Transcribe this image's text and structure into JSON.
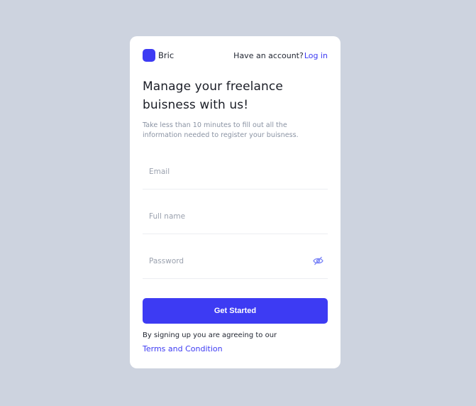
{
  "brand": {
    "name": "Bric",
    "logo_color": "#3D3BF3"
  },
  "header": {
    "account_prompt": "Have an account?",
    "login_label": "Log in"
  },
  "intro": {
    "title_line1": "Manage your freelance",
    "title_line2": "buisness with us!",
    "subtitle": "Take less than 10 minutes to fill out all the information needed to register your buisness."
  },
  "form": {
    "email": {
      "value": "",
      "placeholder": "Email"
    },
    "full_name": {
      "value": "",
      "placeholder": "Full name"
    },
    "password": {
      "value": "",
      "placeholder": "Password",
      "toggle_icon": "eye-off-icon"
    },
    "submit_label": "Get Started"
  },
  "footer": {
    "agreement_text": "By signing up you are agreeing to our",
    "terms_label": "Terms and Condition"
  },
  "colors": {
    "background": "#CDD3DF",
    "card": "#FFFFFF",
    "accent": "#3D3BF3",
    "muted_text": "#8A93A3"
  }
}
